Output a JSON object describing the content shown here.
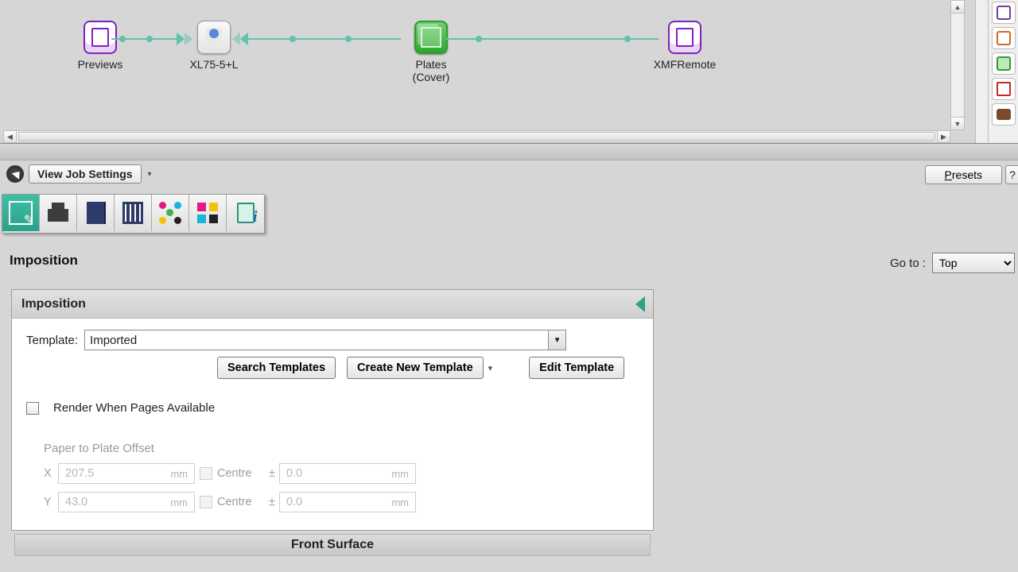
{
  "workflow": {
    "nodes": {
      "previews": "Previews",
      "press": "XL75-5+L",
      "plates_line1": "Plates",
      "plates_line2": "(Cover)",
      "remote": "XMFRemote"
    }
  },
  "settingsBar": {
    "viewJob": "View Job Settings",
    "presets_pre": "P",
    "presets_rest": "resets",
    "help": "?"
  },
  "toolbar": {
    "items": [
      "imposition",
      "print",
      "book",
      "ruler",
      "dots",
      "grid",
      "info"
    ]
  },
  "section": {
    "title": "Imposition",
    "gotoLabel": "Go to :",
    "gotoValue": "Top"
  },
  "panel": {
    "title": "Imposition",
    "templateLabel": "Template:",
    "templateValue": "Imported",
    "searchBtn": "Search Templates",
    "createBtn": "Create New Template",
    "editBtn": "Edit Template",
    "renderLabel": "Render When Pages Available",
    "offsetTitle": "Paper to Plate Offset",
    "xLabel": "X",
    "yLabel": "Y",
    "xVal": "207.5",
    "yVal": "43.0",
    "centreLabel": "Centre",
    "pm": "±",
    "pmX": "0.0",
    "pmY": "0.0",
    "unit": "mm"
  },
  "surface": {
    "front": "Front Surface"
  }
}
